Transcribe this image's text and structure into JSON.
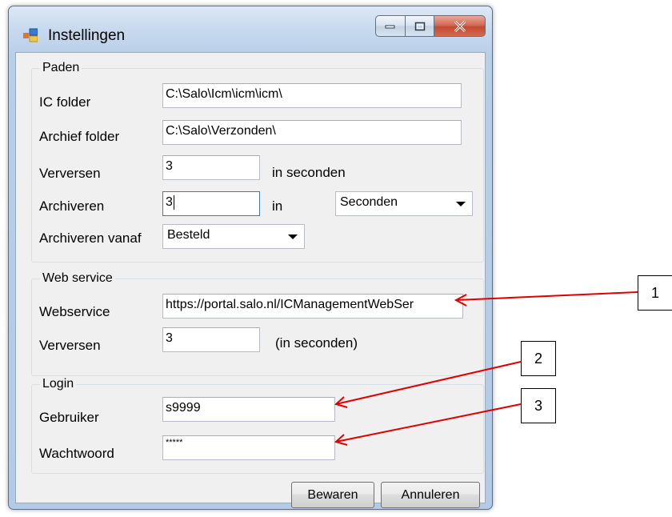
{
  "window": {
    "title": "Instellingen"
  },
  "paden": {
    "legend": "Paden",
    "ic_folder_label": "IC folder",
    "ic_folder_value": "C:\\Salo\\Icm\\icm\\icm\\",
    "archief_folder_label": "Archief folder",
    "archief_folder_value": "C:\\Salo\\Verzonden\\",
    "verversen_label": "Verversen",
    "verversen_value": "3",
    "verversen_unit": "in seconden",
    "archiveren_label": "Archiveren",
    "archiveren_value": "3",
    "archiveren_in": "in",
    "archiveren_unit_selected": "Seconden",
    "archiveren_vanaf_label": "Archiveren vanaf",
    "archiveren_vanaf_selected": "Besteld"
  },
  "webservice": {
    "legend": "Web service",
    "webservice_label": "Webservice",
    "webservice_value": "https://portal.salo.nl/ICManagementWebSer",
    "verversen_label": "Verversen",
    "verversen_value": "3",
    "verversen_unit": "(in seconden)"
  },
  "login": {
    "legend": "Login",
    "gebruiker_label": "Gebruiker",
    "gebruiker_value": "s9999",
    "wachtwoord_label": "Wachtwoord",
    "wachtwoord_value": "*****"
  },
  "buttons": {
    "save": "Bewaren",
    "cancel": "Annuleren"
  },
  "callouts": [
    "1",
    "2",
    "3"
  ],
  "colors": {
    "arrow": "#e00000",
    "focus_border": "#3d7bad"
  }
}
